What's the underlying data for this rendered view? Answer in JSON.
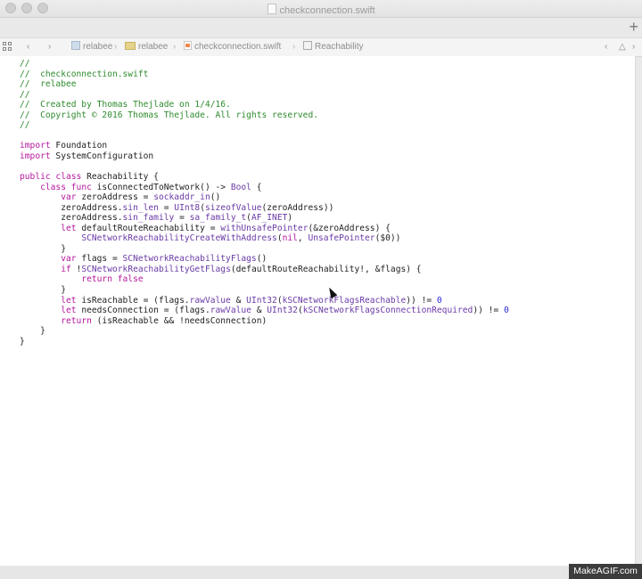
{
  "window": {
    "title": "checkconnection.swift"
  },
  "jumpbar": {
    "items": [
      {
        "label": "relabee",
        "icon": "project-icon"
      },
      {
        "label": "relabee",
        "icon": "folder-icon"
      },
      {
        "label": "checkconnection.swift",
        "icon": "swift-file-icon"
      },
      {
        "label": "Reachability",
        "icon": "class-icon"
      }
    ]
  },
  "editor": {
    "lines": [
      [
        {
          "t": "//",
          "c": "comment"
        }
      ],
      [
        {
          "t": "//  checkconnection.swift",
          "c": "comment"
        }
      ],
      [
        {
          "t": "//  relabee",
          "c": "comment"
        }
      ],
      [
        {
          "t": "//",
          "c": "comment"
        }
      ],
      [
        {
          "t": "//  Created by Thomas Thejlade on 1/4/16.",
          "c": "comment"
        }
      ],
      [
        {
          "t": "//  Copyright © 2016 Thomas Thejlade. All rights reserved.",
          "c": "comment"
        }
      ],
      [
        {
          "t": "//",
          "c": "comment"
        }
      ],
      [],
      [
        {
          "t": "import",
          "c": "keyword"
        },
        {
          "t": " Foundation",
          "c": "plain"
        }
      ],
      [
        {
          "t": "import",
          "c": "keyword"
        },
        {
          "t": " SystemConfiguration",
          "c": "plain"
        }
      ],
      [],
      [
        {
          "t": "public class",
          "c": "keyword"
        },
        {
          "t": " Reachability {",
          "c": "plain"
        }
      ],
      [
        {
          "t": "    ",
          "c": "plain"
        },
        {
          "t": "class func",
          "c": "keyword"
        },
        {
          "t": " isConnectedToNetwork() -> ",
          "c": "plain"
        },
        {
          "t": "Bool",
          "c": "type"
        },
        {
          "t": " {",
          "c": "plain"
        }
      ],
      [
        {
          "t": "        ",
          "c": "plain"
        },
        {
          "t": "var",
          "c": "keyword"
        },
        {
          "t": " zeroAddress = ",
          "c": "plain"
        },
        {
          "t": "sockaddr_in",
          "c": "type"
        },
        {
          "t": "()",
          "c": "plain"
        }
      ],
      [
        {
          "t": "        zeroAddress.",
          "c": "plain"
        },
        {
          "t": "sin_len",
          "c": "type"
        },
        {
          "t": " = ",
          "c": "plain"
        },
        {
          "t": "UInt8",
          "c": "type"
        },
        {
          "t": "(",
          "c": "plain"
        },
        {
          "t": "sizeofValue",
          "c": "type"
        },
        {
          "t": "(zeroAddress))",
          "c": "plain"
        }
      ],
      [
        {
          "t": "        zeroAddress.",
          "c": "plain"
        },
        {
          "t": "sin_family",
          "c": "type"
        },
        {
          "t": " = ",
          "c": "plain"
        },
        {
          "t": "sa_family_t",
          "c": "type"
        },
        {
          "t": "(",
          "c": "plain"
        },
        {
          "t": "AF_INET",
          "c": "type"
        },
        {
          "t": ")",
          "c": "plain"
        }
      ],
      [
        {
          "t": "        ",
          "c": "plain"
        },
        {
          "t": "let",
          "c": "keyword"
        },
        {
          "t": " defaultRouteReachability = ",
          "c": "plain"
        },
        {
          "t": "withUnsafePointer",
          "c": "type"
        },
        {
          "t": "(&zeroAddress) {",
          "c": "plain"
        }
      ],
      [
        {
          "t": "            ",
          "c": "plain"
        },
        {
          "t": "SCNetworkReachabilityCreateWithAddress",
          "c": "type"
        },
        {
          "t": "(",
          "c": "plain"
        },
        {
          "t": "nil",
          "c": "keyword"
        },
        {
          "t": ", ",
          "c": "plain"
        },
        {
          "t": "UnsafePointer",
          "c": "type"
        },
        {
          "t": "($0))",
          "c": "plain"
        }
      ],
      [
        {
          "t": "        }",
          "c": "plain"
        }
      ],
      [
        {
          "t": "        ",
          "c": "plain"
        },
        {
          "t": "var",
          "c": "keyword"
        },
        {
          "t": " flags = ",
          "c": "plain"
        },
        {
          "t": "SCNetworkReachabilityFlags",
          "c": "type"
        },
        {
          "t": "()",
          "c": "plain"
        }
      ],
      [
        {
          "t": "        ",
          "c": "plain"
        },
        {
          "t": "if",
          "c": "keyword"
        },
        {
          "t": " !",
          "c": "plain"
        },
        {
          "t": "SCNetworkReachabilityGetFlags",
          "c": "type"
        },
        {
          "t": "(defaultRouteReachability!, &flags) {",
          "c": "plain"
        }
      ],
      [
        {
          "t": "            ",
          "c": "plain"
        },
        {
          "t": "return false",
          "c": "keyword"
        }
      ],
      [
        {
          "t": "        }",
          "c": "plain"
        }
      ],
      [
        {
          "t": "        ",
          "c": "plain"
        },
        {
          "t": "let",
          "c": "keyword"
        },
        {
          "t": " isReachable = (flags.",
          "c": "plain"
        },
        {
          "t": "rawValue",
          "c": "type"
        },
        {
          "t": " & ",
          "c": "plain"
        },
        {
          "t": "UInt32",
          "c": "type"
        },
        {
          "t": "(",
          "c": "plain"
        },
        {
          "t": "kSCNetworkFlagsReachable",
          "c": "type"
        },
        {
          "t": ")) != ",
          "c": "plain"
        },
        {
          "t": "0",
          "c": "number"
        }
      ],
      [
        {
          "t": "        ",
          "c": "plain"
        },
        {
          "t": "let",
          "c": "keyword"
        },
        {
          "t": " needsConnection = (flags.",
          "c": "plain"
        },
        {
          "t": "rawValue",
          "c": "type"
        },
        {
          "t": " & ",
          "c": "plain"
        },
        {
          "t": "UInt32",
          "c": "type"
        },
        {
          "t": "(",
          "c": "plain"
        },
        {
          "t": "kSCNetworkFlagsConnectionRequired",
          "c": "type"
        },
        {
          "t": ")) != ",
          "c": "plain"
        },
        {
          "t": "0",
          "c": "number"
        }
      ],
      [
        {
          "t": "        ",
          "c": "plain"
        },
        {
          "t": "return",
          "c": "keyword"
        },
        {
          "t": " (isReachable && !needsConnection)",
          "c": "plain"
        }
      ],
      [
        {
          "t": "    }",
          "c": "plain"
        }
      ],
      [
        {
          "t": "}",
          "c": "plain"
        }
      ]
    ]
  },
  "watermark": {
    "text": "MakeAGIF.com"
  }
}
